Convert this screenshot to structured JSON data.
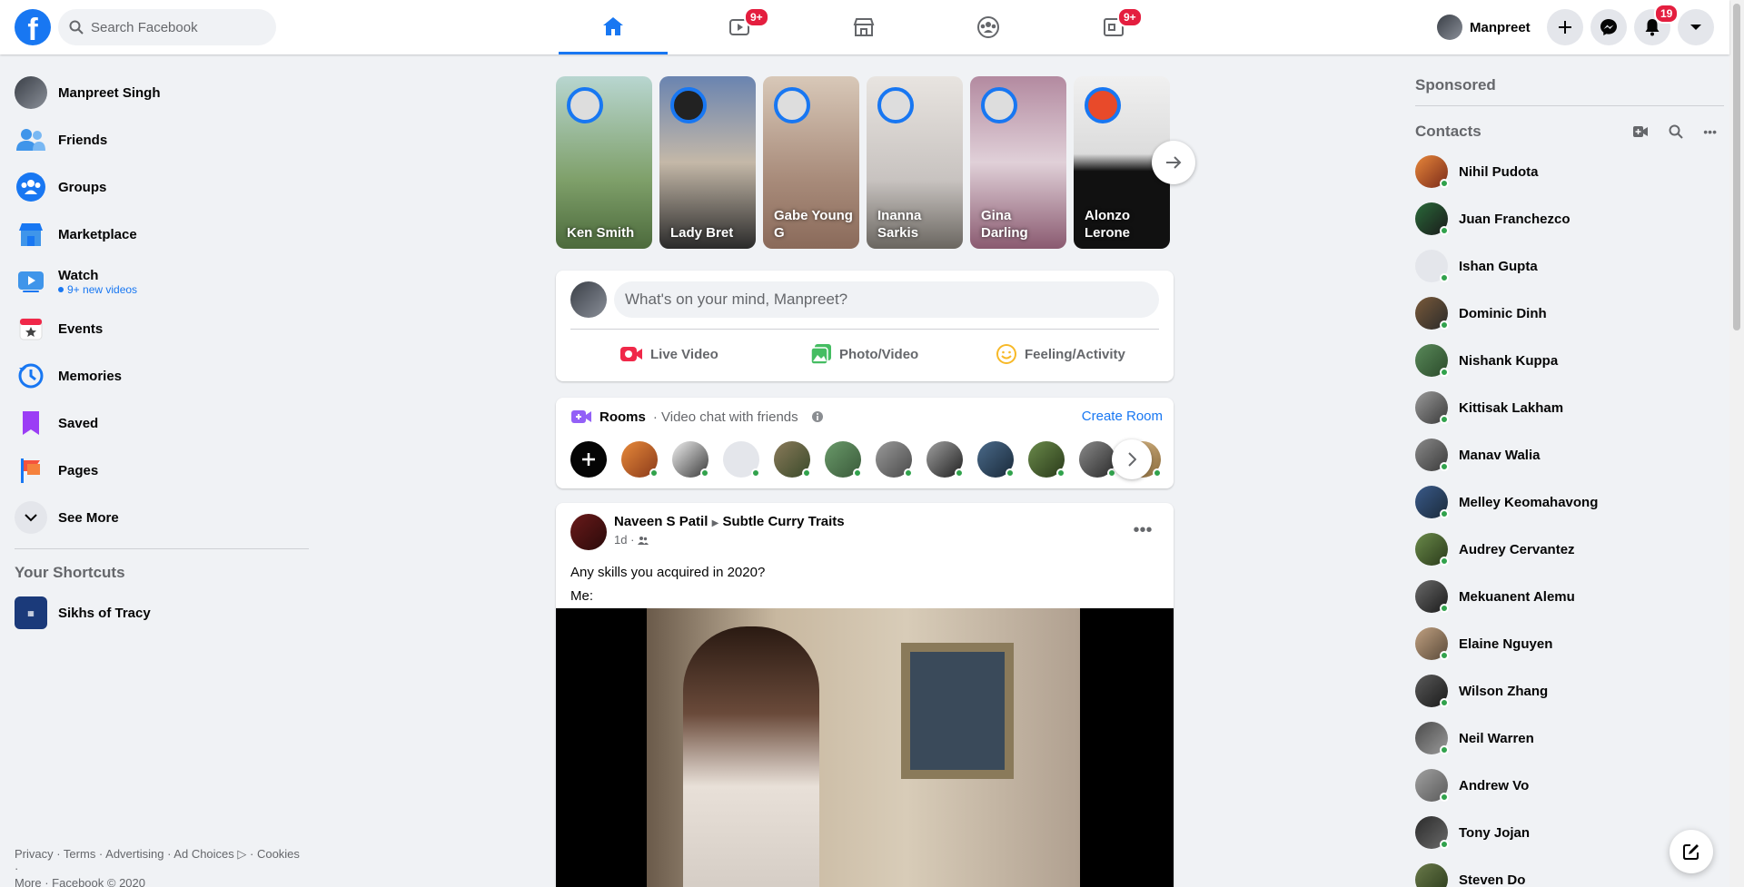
{
  "header": {
    "logo_letter": "f",
    "search_placeholder": "Search Facebook",
    "watch_badge": "9+",
    "gaming_badge": "9+",
    "profile_name": "Manpreet",
    "notifications_badge": "19"
  },
  "sidebar": {
    "items": [
      {
        "label": "Manpreet Singh",
        "icon": "avatar"
      },
      {
        "label": "Friends",
        "icon": "friends-icon"
      },
      {
        "label": "Groups",
        "icon": "groups-icon"
      },
      {
        "label": "Marketplace",
        "icon": "marketplace-icon"
      },
      {
        "label": "Watch",
        "icon": "watch-icon",
        "subtext": "9+ new videos"
      },
      {
        "label": "Events",
        "icon": "events-icon"
      },
      {
        "label": "Memories",
        "icon": "memories-icon"
      },
      {
        "label": "Saved",
        "icon": "saved-icon"
      },
      {
        "label": "Pages",
        "icon": "pages-icon"
      },
      {
        "label": "See More",
        "icon": "chevron-down-icon"
      }
    ],
    "shortcuts_heading": "Your Shortcuts",
    "shortcuts": [
      {
        "label": "Sikhs of Tracy"
      }
    ],
    "footer_line1": "Privacy · Terms · Advertising · Ad Choices ▷ · Cookies ·",
    "footer_line2": "More · Facebook © 2020"
  },
  "stories": [
    {
      "name": "Ken Smith",
      "color": "#7fa06a"
    },
    {
      "name": "Lady Bret",
      "color": "#6a84b0"
    },
    {
      "name": "Gabe Young G",
      "color": "#a88b7a"
    },
    {
      "name": "Inanna Sarkis",
      "color": "#c8c3c0"
    },
    {
      "name": "Gina Darling",
      "color": "#b38aa0"
    },
    {
      "name": "Alonzo Lerone",
      "color": "#222222"
    }
  ],
  "composer": {
    "placeholder": "What's on your mind, Manpreet?",
    "live_video": "Live Video",
    "photo_video": "Photo/Video",
    "feeling": "Feeling/Activity"
  },
  "rooms": {
    "title": "Rooms",
    "subtitle": "· Video chat with friends",
    "create_room": "Create Room"
  },
  "post": {
    "author": "Naveen S Patil",
    "group": "Subtle Curry Traits",
    "time": "1d ·",
    "text_line1": "Any skills you acquired in 2020?",
    "text_line2": "Me:"
  },
  "right": {
    "sponsored": "Sponsored",
    "contacts_heading": "Contacts",
    "contacts": [
      "Nihil Pudota",
      "Juan Franchezco",
      "Ishan Gupta",
      "Dominic Dinh",
      "Nishank Kuppa",
      "Kittisak Lakham",
      "Manav Walia",
      "Melley Keomahavong",
      "Audrey Cervantez",
      "Mekuanent Alemu",
      "Elaine Nguyen",
      "Wilson Zhang",
      "Neil Warren",
      "Andrew Vo",
      "Tony Jojan",
      "Steven Do"
    ]
  },
  "colors": {
    "brand": "#1877f2",
    "badge": "#e41e3f",
    "online": "#31a24c"
  }
}
